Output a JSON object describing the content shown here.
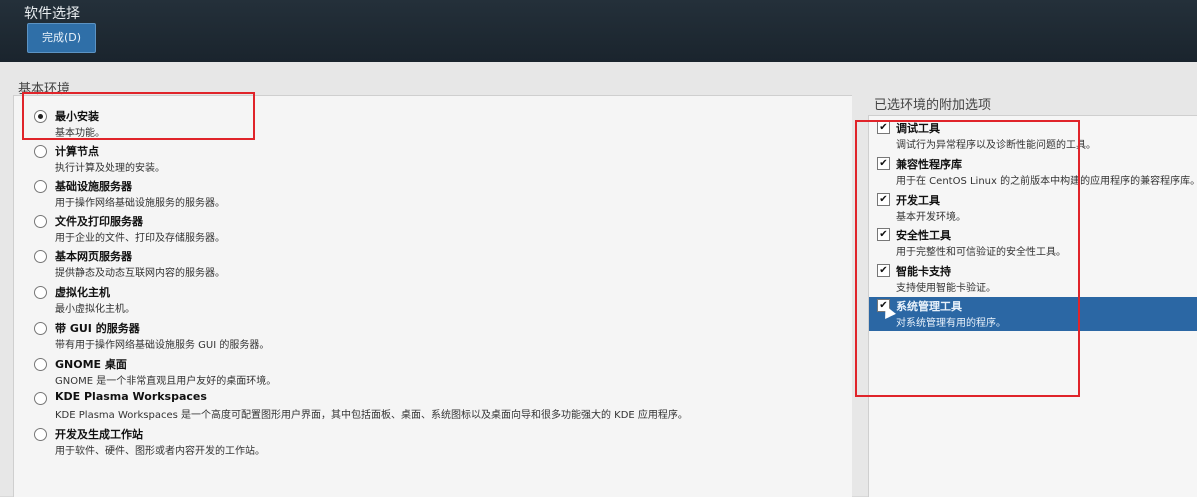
{
  "header": {
    "title": "软件选择",
    "done_label": "完成(D)"
  },
  "base_environment": {
    "title": "基本环境",
    "items": [
      {
        "name": "最小安装",
        "desc": "基本功能。",
        "selected": true
      },
      {
        "name": "计算节点",
        "desc": "执行计算及处理的安装。",
        "selected": false
      },
      {
        "name": "基础设施服务器",
        "desc": "用于操作网络基础设施服务的服务器。",
        "selected": false
      },
      {
        "name": "文件及打印服务器",
        "desc": "用于企业的文件、打印及存储服务器。",
        "selected": false
      },
      {
        "name": "基本网页服务器",
        "desc": "提供静态及动态互联网内容的服务器。",
        "selected": false
      },
      {
        "name": "虚拟化主机",
        "desc": "最小虚拟化主机。",
        "selected": false
      },
      {
        "name": "带 GUI 的服务器",
        "desc": "带有用于操作网络基础设施服务 GUI 的服务器。",
        "selected": false
      },
      {
        "name": "GNOME 桌面",
        "desc": "GNOME 是一个非常直观且用户友好的桌面环境。",
        "selected": false
      },
      {
        "name": "KDE Plasma Workspaces",
        "desc": "KDE Plasma Workspaces 是一个高度可配置图形用户界面，其中包括面板、桌面、系统图标以及桌面向导和很多功能强大的 KDE 应用程序。",
        "selected": false
      },
      {
        "name": "开发及生成工作站",
        "desc": "用于软件、硬件、图形或者内容开发的工作站。",
        "selected": false
      }
    ]
  },
  "addons": {
    "title": "已选环境的附加选项",
    "items": [
      {
        "name": "调试工具",
        "desc": "调试行为异常程序以及诊断性能问题的工具。",
        "checked": true,
        "highlighted": false
      },
      {
        "name": "兼容性程序库",
        "desc": "用于在 CentOS Linux 的之前版本中构建的应用程序的兼容程序库。",
        "checked": true,
        "highlighted": false
      },
      {
        "name": "开发工具",
        "desc": "基本开发环境。",
        "checked": true,
        "highlighted": false
      },
      {
        "name": "安全性工具",
        "desc": "用于完整性和可信验证的安全性工具。",
        "checked": true,
        "highlighted": false
      },
      {
        "name": "智能卡支持",
        "desc": "支持使用智能卡验证。",
        "checked": true,
        "highlighted": false
      },
      {
        "name": "系统管理工具",
        "desc": "对系统管理有用的程序。",
        "checked": true,
        "highlighted": true
      }
    ]
  },
  "colors": {
    "selection": "#2b67a4",
    "annotation": "#e0242a"
  }
}
